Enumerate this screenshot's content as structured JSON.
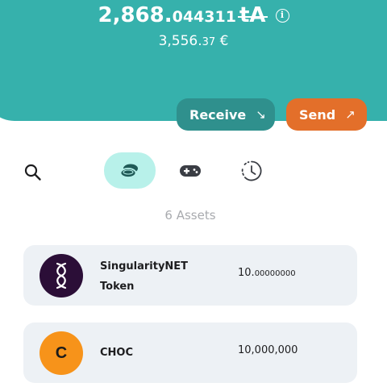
{
  "balance": {
    "integer": "2,868.",
    "decimal": "044311",
    "currency": "tA",
    "info_icon": "info-icon",
    "fiat_integer": "3,556.",
    "fiat_decimal": "37",
    "fiat_currency": " €"
  },
  "actions": {
    "receive_label": "Receive",
    "receive_arrow": "↘",
    "send_label": "Send",
    "send_arrow": "↗"
  },
  "tabs": [
    {
      "icon": "coins-icon",
      "active": true
    },
    {
      "icon": "gamepad-icon",
      "active": false
    },
    {
      "icon": "history-icon",
      "active": false
    }
  ],
  "assets_count": "6 Assets",
  "assets": [
    {
      "name": "SingularityNET Token",
      "amount_integer": "10.",
      "amount_decimal": "00000000",
      "icon": "singularitynet-logo-icon"
    },
    {
      "name": "CHOC",
      "logo_letter": "C",
      "amount_integer": "10,000,000",
      "amount_decimal": "",
      "icon": "choc-logo-icon"
    }
  ],
  "colors": {
    "header": "#36b1ac",
    "receive_button": "#2f908d",
    "send_button": "#e36f2a",
    "active_tab": "#b8f1ea",
    "card": "#edf1f5"
  }
}
